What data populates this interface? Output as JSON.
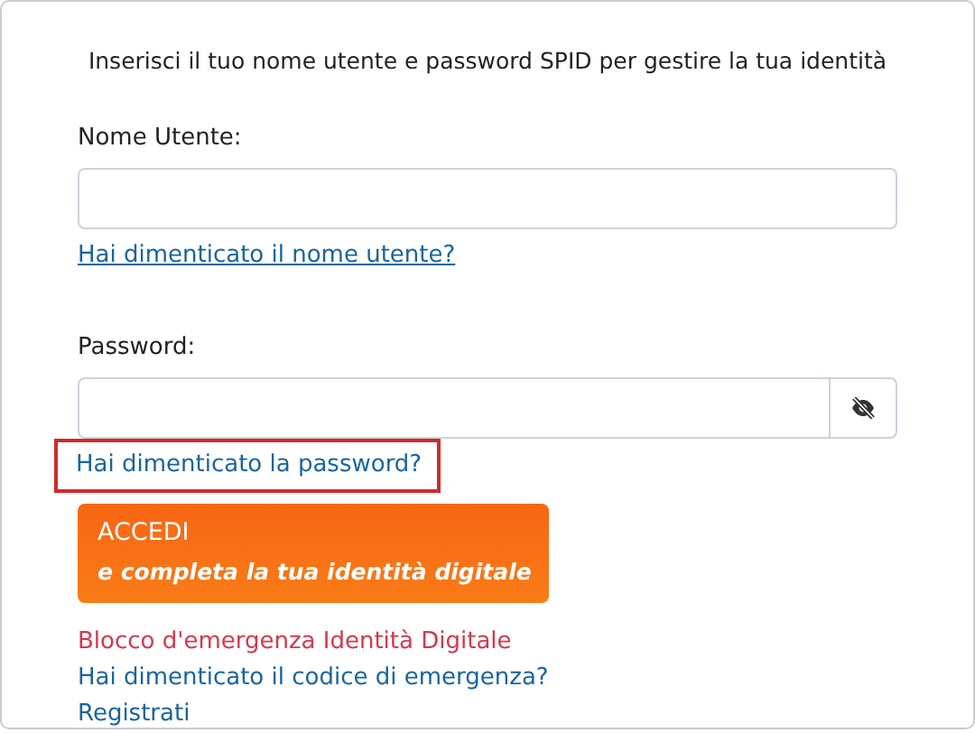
{
  "intro": "Inserisci il tuo nome utente e password SPID per gestire la tua identità",
  "fields": [
    {
      "label": "Nome Utente:",
      "kind": "text",
      "link": {
        "text": "Hai dimenticato il nome utente?",
        "underlined": true,
        "highlighted": false
      }
    },
    {
      "label": "Password:",
      "kind": "password",
      "link": {
        "text": "Hai dimenticato la password?",
        "underlined": false,
        "highlighted": true
      }
    }
  ],
  "submit": {
    "title": "ACCEDI",
    "subtitle": "e completa la tua identità digitale"
  },
  "links": [
    {
      "text": "Blocco d'emergenza Identità Digitale",
      "color": "#d9364f"
    },
    {
      "text": "Hai dimenticato il codice di emergenza?",
      "color": "#17659f"
    },
    {
      "text": "Registrati",
      "color": "#17659f"
    }
  ]
}
